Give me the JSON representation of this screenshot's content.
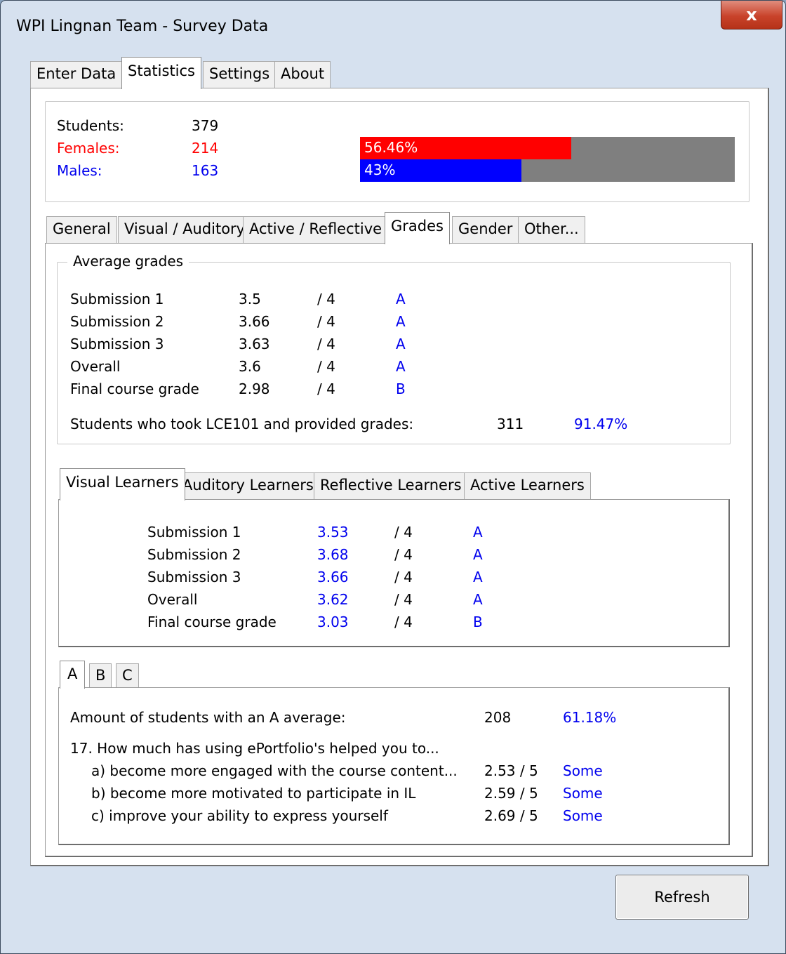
{
  "window": {
    "title": "WPI Lingnan Team - Survey Data",
    "close_glyph": "x"
  },
  "main_tabs": [
    "Enter Data",
    "Statistics",
    "Settings",
    "About"
  ],
  "summary": {
    "students_label": "Students:",
    "students_value": "379",
    "females_label": "Females:",
    "females_value": "214",
    "males_label": "Males:",
    "males_value": "163",
    "female_bar_text": "56.46%",
    "female_fraction": 0.5646,
    "male_bar_text": "43%",
    "male_fraction": 0.43,
    "female_color": "#ff0000",
    "male_color": "#0000ff",
    "bar_bg_color": "#7f7f7f"
  },
  "stats_tabs": [
    "General",
    "Visual / Auditory",
    "Active / Reflective",
    "Grades",
    "Gender",
    "Other..."
  ],
  "average_grades": {
    "title": "Average grades",
    "rows": [
      {
        "label": "Submission 1",
        "value": "3.5",
        "scale": "/ 4",
        "letter": "A"
      },
      {
        "label": "Submission 2",
        "value": "3.66",
        "scale": "/ 4",
        "letter": "A"
      },
      {
        "label": "Submission 3",
        "value": "3.63",
        "scale": "/ 4",
        "letter": "A"
      },
      {
        "label": "Overall",
        "value": "3.6",
        "scale": "/ 4",
        "letter": "A"
      },
      {
        "label": "Final course grade",
        "value": "2.98",
        "scale": "/ 4",
        "letter": "B"
      }
    ],
    "provided_label": "Students who took LCE101 and provided grades:",
    "provided_count": "311",
    "provided_pct": "91.47%"
  },
  "learner_tabs": [
    "Visual Learners",
    "Auditory Learners",
    "Reflective Learners",
    "Active Learners"
  ],
  "learner_grades": [
    {
      "label": "Submission 1",
      "value": "3.53",
      "scale": "/ 4",
      "letter": "A"
    },
    {
      "label": "Submission 2",
      "value": "3.68",
      "scale": "/ 4",
      "letter": "A"
    },
    {
      "label": "Submission 3",
      "value": "3.66",
      "scale": "/ 4",
      "letter": "A"
    },
    {
      "label": "Overall",
      "value": "3.62",
      "scale": "/ 4",
      "letter": "A"
    },
    {
      "label": "Final course grade",
      "value": "3.03",
      "scale": "/ 4",
      "letter": "B"
    }
  ],
  "grade_tabs": [
    "A",
    "B",
    "C"
  ],
  "grade_a": {
    "amount_label": "Amount of students with an A average:",
    "amount_count": "208",
    "amount_pct": "61.18%",
    "question": "17. How much has using ePortfolio's helped you to...",
    "items": [
      {
        "label": "a) become more engaged with the course content...",
        "score": "2.53 / 5",
        "rating": "Some"
      },
      {
        "label": "b) become more motivated to participate in IL",
        "score": "2.59 / 5",
        "rating": "Some"
      },
      {
        "label": "c) improve your ability to express yourself",
        "score": "2.69 / 5",
        "rating": "Some"
      }
    ]
  },
  "refresh_label": "Refresh"
}
